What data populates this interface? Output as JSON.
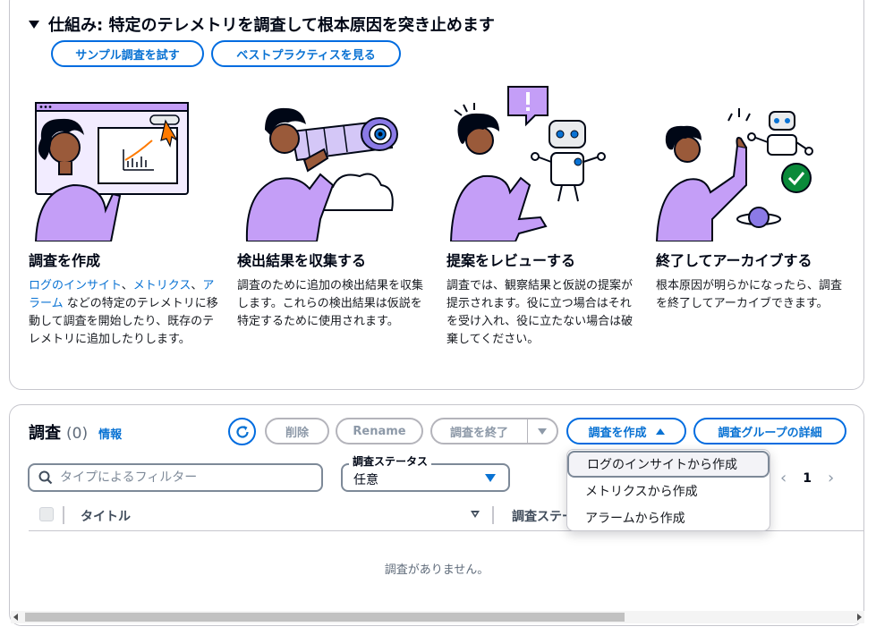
{
  "how_it_works": {
    "title": "仕組み: 特定のテレメトリを調査して根本原因を突き止めます",
    "try_sample_button": "サンプル調査を試す",
    "best_practices_button": "ベストプラクティスを見る",
    "steps": [
      {
        "title": "調査を作成",
        "desc_link_1": "ログのインサイト",
        "desc_sep_1": "、",
        "desc_link_2": "メトリクス",
        "desc_sep_2": "、",
        "desc_link_3": "アラーム",
        "desc_rest": " などの特定のテレメトリに移動して調査を開始したり、既存のテレメトリに追加したりします。"
      },
      {
        "title": "検出結果を収集する",
        "desc": "調査のために追加の検出結果を収集します。これらの検出結果は仮説を特定するために使用されます。"
      },
      {
        "title": "提案をレビューする",
        "desc": "調査では、観察結果と仮説の提案が提示されます。役に立つ場合はそれを受け入れ、役に立たない場合は破棄してください。"
      },
      {
        "title": "終了してアーカイブする",
        "desc": "根本原因が明らかになったら、調査を終了してアーカイブできます。"
      }
    ]
  },
  "investigations": {
    "title": "調査",
    "count": "(0)",
    "info_link": "情報",
    "buttons": {
      "delete": "削除",
      "rename": "Rename",
      "end": "調査を終了",
      "create": "調査を作成",
      "group_details": "調査グループの詳細"
    },
    "filter_placeholder": "タイプによるフィルター",
    "status_filter": {
      "label": "調査ステータス",
      "value": "任意"
    },
    "pager": {
      "page": "1"
    },
    "columns": {
      "title": "タイトル",
      "status": "調査ステータス"
    },
    "empty_text": "調査がありません。",
    "create_menu": [
      "ログのインサイトから作成",
      "メトリクスから作成",
      "アラームから作成"
    ]
  },
  "colors": {
    "accent": "#0972d3",
    "illustration_purple": "#c49ef7",
    "illustration_green": "#0a8a3a"
  }
}
